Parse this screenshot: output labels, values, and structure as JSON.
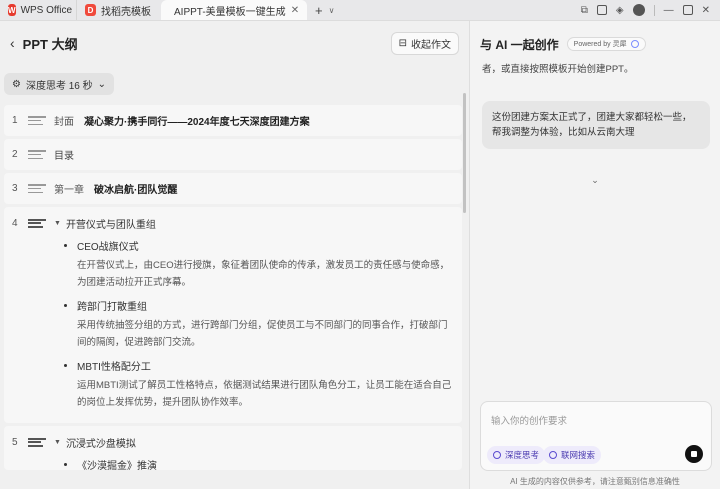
{
  "tabs": {
    "wps": "WPS Office",
    "t2": "找稻壳模板",
    "active": "AIPPT-美量模板一键生成",
    "add": "+"
  },
  "header": {
    "back_icon": "‹",
    "title": "PPT 大纲",
    "collapse_label": "收起作文"
  },
  "think": {
    "label": "深度思考 16 秒",
    "chevron": "⌄"
  },
  "outline": [
    {
      "num": "1",
      "kind": "封面",
      "title": "凝心聚力·携手同行——2024年度七天深度团建方案"
    },
    {
      "num": "2",
      "kind": "",
      "title": "目录"
    },
    {
      "num": "3",
      "kind": "第一章",
      "title": "破冰启航·团队觉醒"
    },
    {
      "num": "4",
      "title": "开营仪式与团队重组",
      "items": [
        {
          "title": "CEO战旗仪式",
          "desc": "在开营仪式上，由CEO进行授旗，象征着团队使命的传承，激发员工的责任感与使命感，为团建活动拉开正式序幕。"
        },
        {
          "title": "跨部门打散重组",
          "desc": "采用传统抽签分组的方式，进行跨部门分组，促使员工与不同部门的同事合作，打破部门间的隔阂，促进跨部门交流。"
        },
        {
          "title": "MBTI性格配分工",
          "desc": "运用MBTI测试了解员工性格特点，依据测试结果进行团队角色分工，让员工能在适合自己的岗位上发挥优势，提升团队协作效率。"
        }
      ]
    },
    {
      "num": "5",
      "title": "沉浸式沙盘模拟",
      "items": [
        {
          "title": "《沙漠掘金》推演",
          "desc": ""
        }
      ]
    }
  ],
  "right": {
    "title": "与 AI 一起创作",
    "powered": "Powered by 灵犀",
    "ai_tail": "者，或直接按照模板开始创建PPT。",
    "user_msg": "这份团建方案太正式了，团建大家都轻松一些，帮我调整为体验，比如从云南大理",
    "expand": "⌄",
    "input_placeholder": "输入你的创作要求",
    "chip1": "深度思考",
    "chip2": "联网搜索",
    "footnote": "AI 生成的内容仅供参考，请注意甄别信息准确性"
  },
  "colors": {
    "accent": "#5b4bd0",
    "wps_red": "#e63a2e"
  }
}
